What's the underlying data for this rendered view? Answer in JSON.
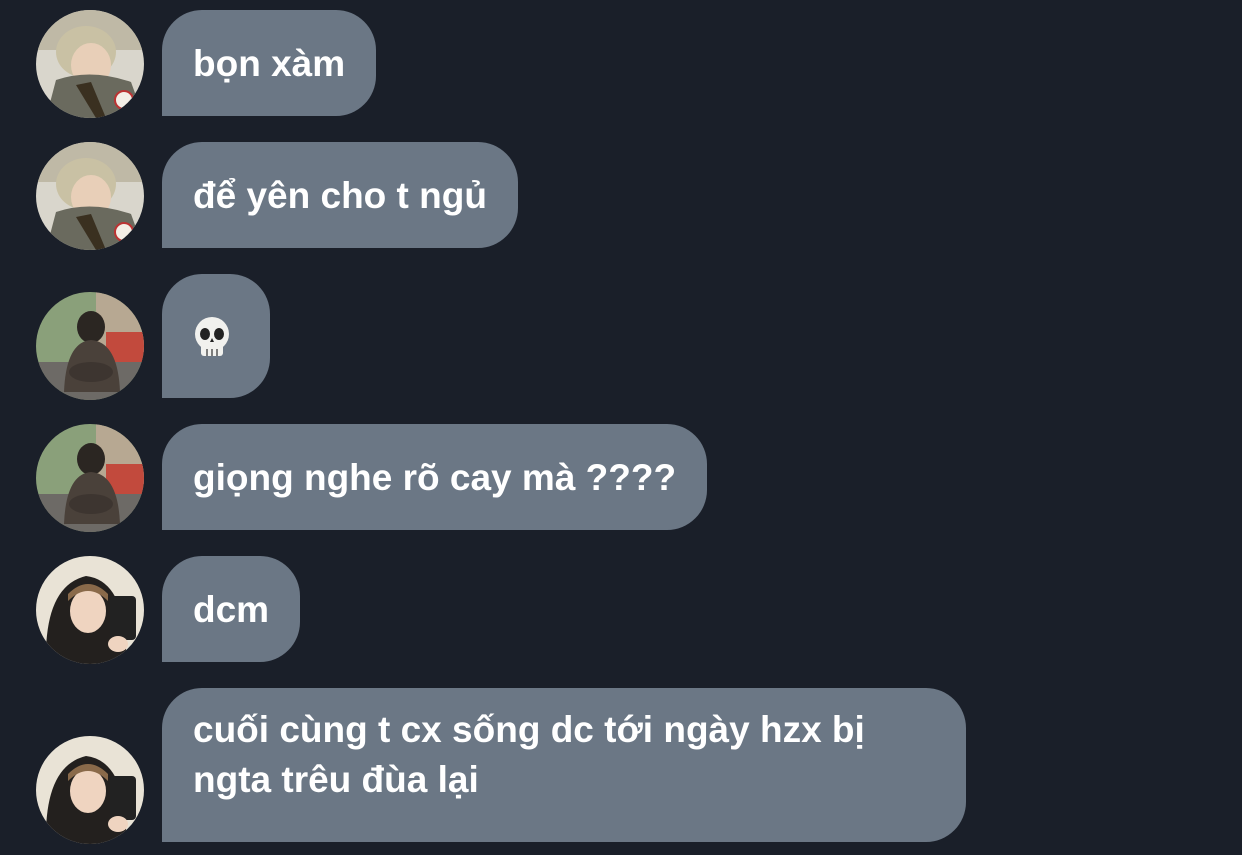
{
  "messages": [
    {
      "sender": "user-a",
      "avatar": "avatar-blonde-hair",
      "text": "bọn xàm"
    },
    {
      "sender": "user-a",
      "avatar": "avatar-blonde-hair",
      "text": "để yên cho t ngủ"
    },
    {
      "sender": "user-b",
      "avatar": "avatar-hoodie-outdoor",
      "text": "",
      "emoji": "skull-icon"
    },
    {
      "sender": "user-b",
      "avatar": "avatar-hoodie-outdoor",
      "text": "giọng nghe rõ cay mà ????"
    },
    {
      "sender": "user-c",
      "avatar": "avatar-mirror-selfie",
      "text": "dcm"
    },
    {
      "sender": "user-c",
      "avatar": "avatar-mirror-selfie",
      "text": "cuối cùng t cx sống dc tới ngày hzx bị ngta trêu đùa lại"
    }
  ],
  "colors": {
    "background": "#1a1f29",
    "bubble": "#6b7785",
    "text": "#ffffff"
  }
}
